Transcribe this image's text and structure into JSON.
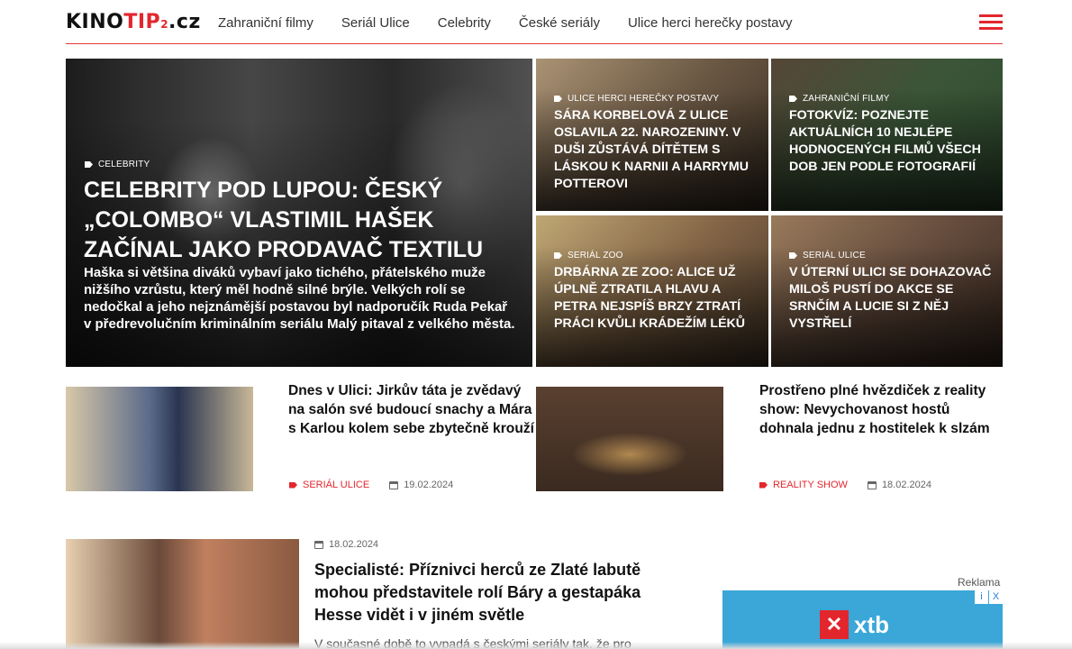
{
  "header": {
    "logo_part1": "KINO",
    "logo_part2": "TIP",
    "logo_sub": "2",
    "logo_domain": ".cz",
    "nav": [
      "Zahraniční filmy",
      "Seriál Ulice",
      "Celebrity",
      "České seriály",
      "Ulice herci herečky postavy"
    ]
  },
  "hero": {
    "category": "CELEBRITY",
    "title": "CELEBRITY POD LUPOU: ČESKÝ „COLOMBO“ VLASTIMIL HAŠEK ZAČÍNAL JAKO PRODAVAČ TEXTILU",
    "excerpt": "Haška si většina diváků vybaví jako tichého, přátelského muže nižšího vzrůstu, který měl hodně silné brýle. Velkých rolí se nedočkal a jeho nejznámější postavou byl nadporučík Ruda Pekař v předrevolučním kriminálním seriálu Malý pitaval z velkého města."
  },
  "tiles": [
    {
      "category": "ULICE HERCI HEREČKY POSTAVY",
      "title": "SÁRA KORBELOVÁ Z ULICE OSLAVILA 22. NAROZENINY. V DUŠI ZŮSTÁVÁ DÍTĚTEM S LÁSKOU K NARNII A HARRYMU POTTEROVI"
    },
    {
      "category": "ZAHRANIČNÍ FILMY",
      "title": "FOTOKVÍZ: POZNEJTE AKTUÁLNÍCH 10 NEJLÉPE HODNOCENÝCH FILMŮ VŠECH DOB JEN PODLE FOTOGRAFIÍ"
    },
    {
      "category": "SERIÁL ZOO",
      "title": "DRBÁRNA ZE ZOO: ALICE UŽ ÚPLNĚ ZTRATILA HLAVU A PETRA NEJSPÍŠ BRZY ZTRATÍ PRÁCI KVŮLI KRÁDEŽÍM LÉKŮ"
    },
    {
      "category": "SERIÁL ULICE",
      "title": "V ÚTERNÍ ULICI SE DOHAZOVAČ MILOŠ PUSTÍ DO AKCE SE SRNČÍM A LUCIE SI Z NĚJ VYSTŘELÍ"
    }
  ],
  "articles": [
    {
      "title": "Dnes v Ulici: Jirkův táta je zvědavý na salón své budoucí snachy a Mára s Karlou kolem sebe zbytečně krouží",
      "category": "SERIÁL ULICE",
      "date": "19.02.2024"
    },
    {
      "title": "Prostřeno plné hvězdiček z reality show: Nevychovanost hostů dohnala jednu z hostitelek k slzám",
      "category": "REALITY SHOW",
      "date": "18.02.2024"
    }
  ],
  "feature": {
    "date": "18.02.2024",
    "title": "Specialisté: Příznivci herců ze Zlaté labutě mohou představitele rolí Báry a gestapáka Hesse vidět i v jiném světle",
    "excerpt": "V současné době to vypadá s českými seriály tak, že pro"
  },
  "ad": {
    "label": "Reklama",
    "brand": "xtb",
    "badge_i": "i",
    "badge_x": "X"
  }
}
